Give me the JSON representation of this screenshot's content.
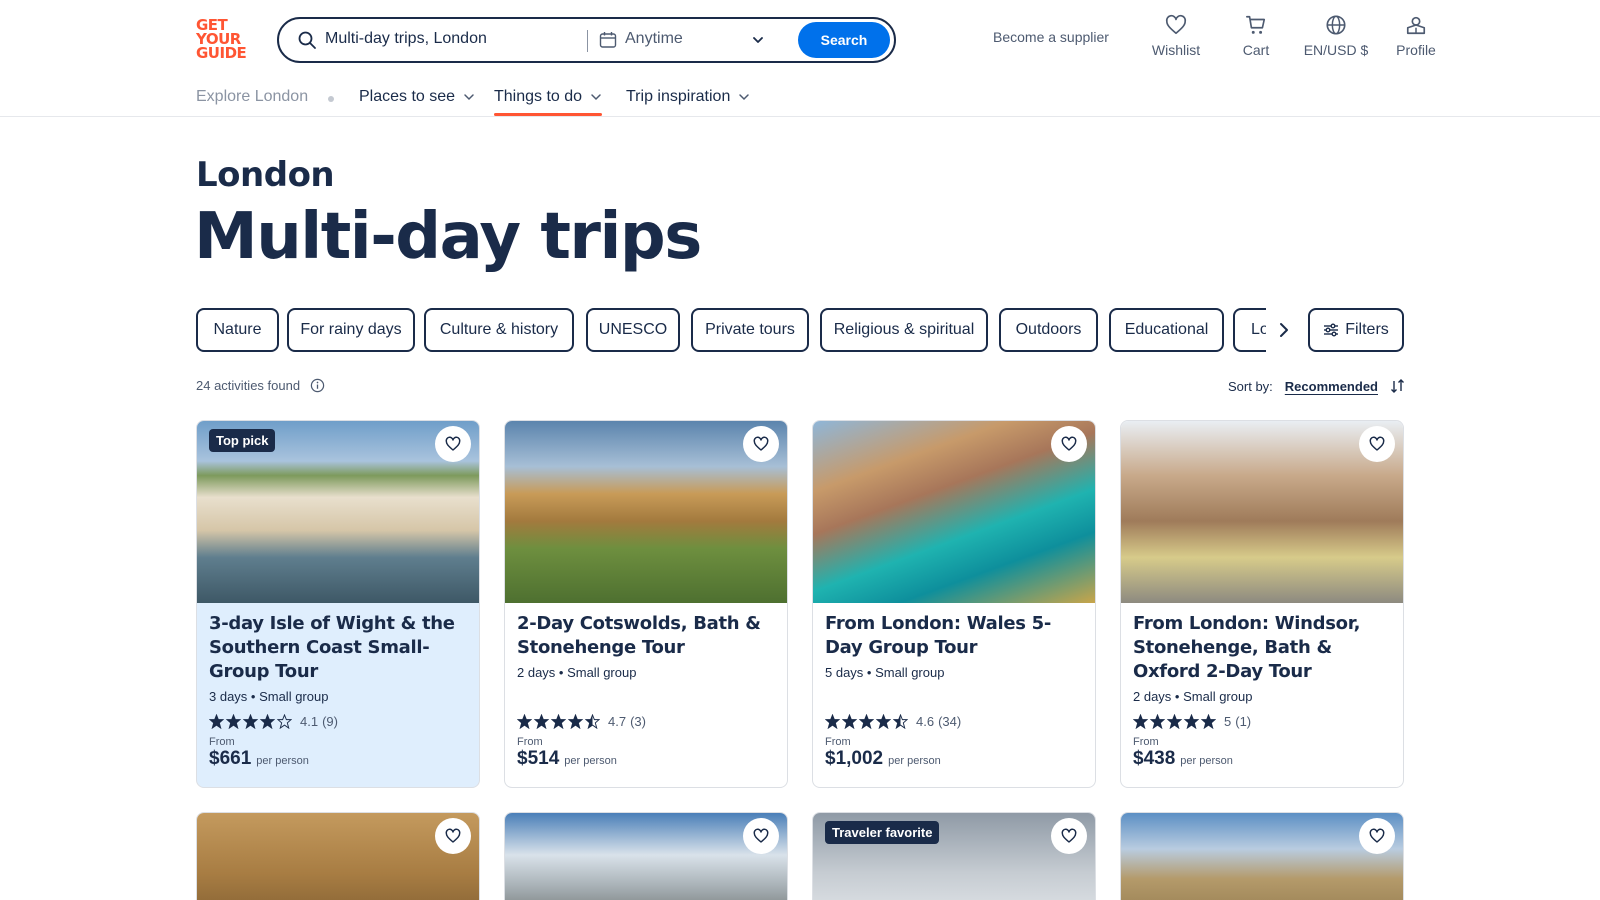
{
  "header": {
    "logo_lines": [
      "GET",
      "YOUR",
      "GUIDE"
    ],
    "search_text": "Multi-day trips, London",
    "date_text": "Anytime",
    "search_button": "Search",
    "supplier": "Become a supplier",
    "wishlist": "Wishlist",
    "cart": "Cart",
    "language": "EN/USD $",
    "profile": "Profile"
  },
  "subnav": {
    "explore": "Explore London",
    "places": "Places to see",
    "things": "Things to do",
    "inspiration": "Trip inspiration"
  },
  "page": {
    "city": "London",
    "title": "Multi-day trips"
  },
  "chips": [
    "Nature",
    "For rainy days",
    "Culture & history",
    "UNESCO",
    "Private tours",
    "Religious & spiritual",
    "Outdoors",
    "Educational",
    "Lo"
  ],
  "filters_label": "Filters",
  "results": {
    "count": "24 activities found",
    "sort_label": "Sort by:",
    "sort_value": "Recommended"
  },
  "cards": [
    {
      "badge": "Top pick",
      "title": "3-day Isle of Wight & the Southern Coast Small-Group Tour",
      "meta": "3 days • Small group",
      "stars": 4,
      "score": "4.1",
      "reviews": "(9)",
      "from": "From",
      "price": "$661",
      "per": "per person"
    },
    {
      "badge": "",
      "title": "2-Day Cotswolds, Bath & Stonehenge Tour",
      "meta": "2 days • Small group",
      "stars": 4.5,
      "score": "4.7",
      "reviews": "(3)",
      "from": "From",
      "price": "$514",
      "per": "per person"
    },
    {
      "badge": "",
      "title": "From London: Wales 5-Day Group Tour",
      "meta": "5 days • Small group",
      "stars": 4.5,
      "score": "4.6",
      "reviews": "(34)",
      "from": "From",
      "price": "$1,002",
      "per": "per person"
    },
    {
      "badge": "",
      "title": "From London: Windsor, Stonehenge, Bath & Oxford 2-Day Tour",
      "meta": "2 days • Small group",
      "stars": 5,
      "score": "5",
      "reviews": "(1)",
      "from": "From",
      "price": "$438",
      "per": "per person"
    }
  ],
  "second_row_badges": [
    "",
    "",
    "Traveler favorite",
    ""
  ],
  "colors": {
    "brand": "#ff5533",
    "primary": "#0071eb",
    "text": "#1a2b49",
    "highlight": "#dfeefd"
  }
}
